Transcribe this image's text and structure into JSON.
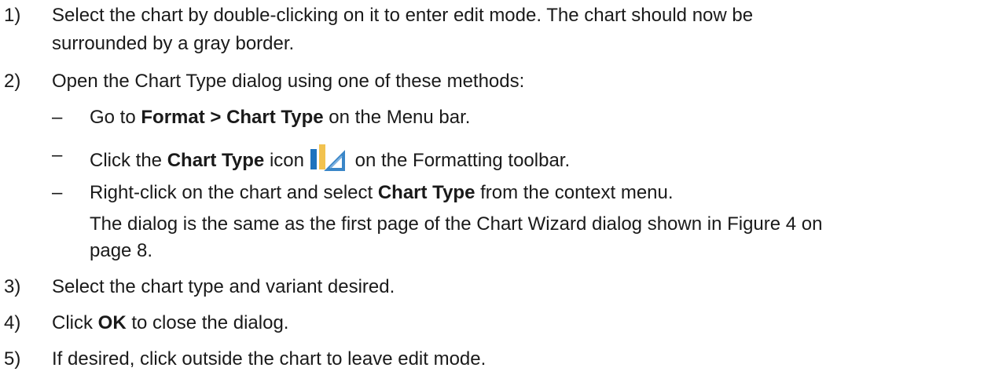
{
  "steps": [
    {
      "number": "1)",
      "line1": "Select the chart by double-clicking on it to enter edit mode. The chart should now be",
      "line2": "surrounded by a gray border."
    },
    {
      "number": "2)",
      "text": "Open the Chart Type dialog using one of these methods:",
      "methods": [
        {
          "dash": "–",
          "before": "Go to ",
          "bold": "Format > Chart Type",
          "after": " on the Menu bar."
        },
        {
          "dash": "–",
          "before": "Click the ",
          "bold": "Chart Type",
          "mid": " icon",
          "after": " on the Formatting toolbar.",
          "icon": "chart-type-icon"
        },
        {
          "dash": "–",
          "before": "Right-click on the chart and select ",
          "bold": "Chart Type",
          "after": " from the context menu."
        }
      ],
      "note_line1": "The dialog is the same as the first page of the Chart Wizard dialog shown in Figure 4 on",
      "note_line2": "page 8."
    },
    {
      "number": "3)",
      "text": "Select the chart type and variant desired."
    },
    {
      "number": "4)",
      "before": "Click ",
      "bold": "OK",
      "after": " to close the dialog."
    },
    {
      "number": "5)",
      "text": "If desired, click outside the chart to leave edit mode."
    }
  ],
  "colors": {
    "text": "#1a1a1a",
    "icon_bar_blue": "#1e73be",
    "icon_bar_yellow": "#f2c24f",
    "icon_triangle_blue": "#3a86c8"
  }
}
